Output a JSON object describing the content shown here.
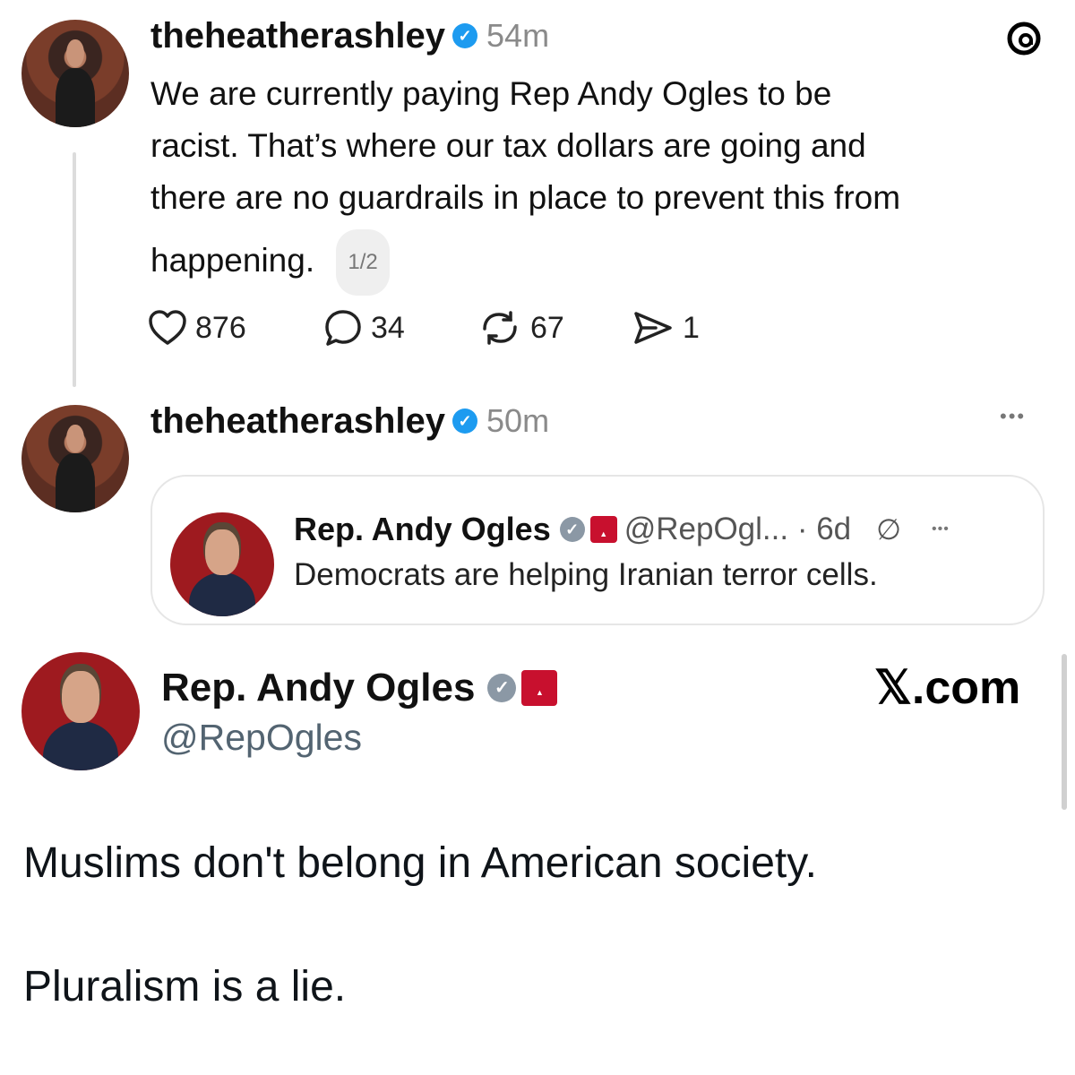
{
  "post1": {
    "username": "theheatherashley",
    "time": "54m",
    "text_lines": [
      "We are currently paying Rep Andy Ogles to be",
      "racist. That’s where our tax dollars are going and",
      "there are no guardrails in place to prevent this from",
      "happening."
    ],
    "thread_counter": "1/2",
    "likes": "876",
    "replies": "34",
    "reposts": "67",
    "shares": "1"
  },
  "post2": {
    "username": "theheatherashley",
    "time": "50m",
    "more_label": "•••",
    "quote": {
      "name": "Rep. Andy Ogles",
      "meta": "@RepOgl... · 6d",
      "text": "Democrats are helping Iranian terror cells.",
      "more_label": "•••"
    }
  },
  "screenshot_tweet": {
    "name": "Rep. Andy Ogles",
    "handle": "@RepOgles",
    "brand": "𝕏.com",
    "body_line1": "Muslims don't belong in American society.",
    "body_line2": "Pluralism is a lie."
  },
  "icons": {
    "threads_logo": "threads-logo-icon",
    "verified": "verified-badge-icon",
    "heart": "heart-icon",
    "reply": "reply-icon",
    "repost": "repost-icon",
    "share": "send-icon"
  },
  "colors": {
    "verified_blue": "#1d9bf0",
    "gop_red": "#c8102e",
    "meta_gray": "#8a8a8a"
  }
}
